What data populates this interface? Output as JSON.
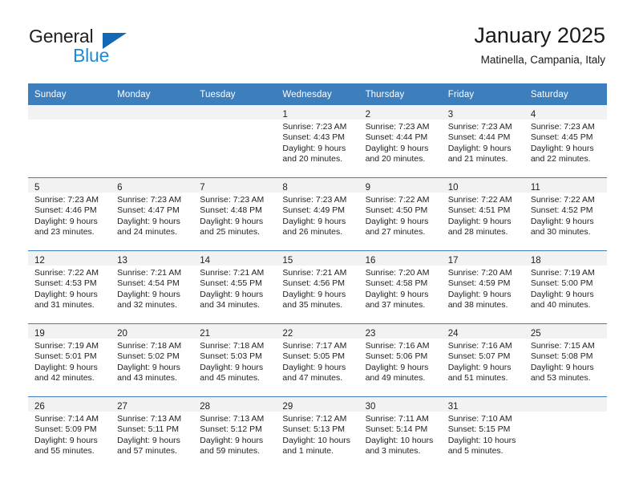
{
  "brand": {
    "name_part1": "General",
    "name_part2": "Blue",
    "triangle_color": "#1268b3",
    "blue_color": "#1e8ad6"
  },
  "header": {
    "month_title": "January 2025",
    "location": "Matinella, Campania, Italy"
  },
  "theme": {
    "header_blue": "#3d7ebd",
    "daynum_band": "#f2f2f2",
    "text": "#222222"
  },
  "weekday_headers": [
    "Sunday",
    "Monday",
    "Tuesday",
    "Wednesday",
    "Thursday",
    "Friday",
    "Saturday"
  ],
  "weeks": [
    [
      {
        "day": "",
        "sunrise": "",
        "sunset": "",
        "daylight_1": "",
        "daylight_2": ""
      },
      {
        "day": "",
        "sunrise": "",
        "sunset": "",
        "daylight_1": "",
        "daylight_2": ""
      },
      {
        "day": "",
        "sunrise": "",
        "sunset": "",
        "daylight_1": "",
        "daylight_2": ""
      },
      {
        "day": "1",
        "sunrise": "Sunrise: 7:23 AM",
        "sunset": "Sunset: 4:43 PM",
        "daylight_1": "Daylight: 9 hours",
        "daylight_2": "and 20 minutes."
      },
      {
        "day": "2",
        "sunrise": "Sunrise: 7:23 AM",
        "sunset": "Sunset: 4:44 PM",
        "daylight_1": "Daylight: 9 hours",
        "daylight_2": "and 20 minutes."
      },
      {
        "day": "3",
        "sunrise": "Sunrise: 7:23 AM",
        "sunset": "Sunset: 4:44 PM",
        "daylight_1": "Daylight: 9 hours",
        "daylight_2": "and 21 minutes."
      },
      {
        "day": "4",
        "sunrise": "Sunrise: 7:23 AM",
        "sunset": "Sunset: 4:45 PM",
        "daylight_1": "Daylight: 9 hours",
        "daylight_2": "and 22 minutes."
      }
    ],
    [
      {
        "day": "5",
        "sunrise": "Sunrise: 7:23 AM",
        "sunset": "Sunset: 4:46 PM",
        "daylight_1": "Daylight: 9 hours",
        "daylight_2": "and 23 minutes."
      },
      {
        "day": "6",
        "sunrise": "Sunrise: 7:23 AM",
        "sunset": "Sunset: 4:47 PM",
        "daylight_1": "Daylight: 9 hours",
        "daylight_2": "and 24 minutes."
      },
      {
        "day": "7",
        "sunrise": "Sunrise: 7:23 AM",
        "sunset": "Sunset: 4:48 PM",
        "daylight_1": "Daylight: 9 hours",
        "daylight_2": "and 25 minutes."
      },
      {
        "day": "8",
        "sunrise": "Sunrise: 7:23 AM",
        "sunset": "Sunset: 4:49 PM",
        "daylight_1": "Daylight: 9 hours",
        "daylight_2": "and 26 minutes."
      },
      {
        "day": "9",
        "sunrise": "Sunrise: 7:22 AM",
        "sunset": "Sunset: 4:50 PM",
        "daylight_1": "Daylight: 9 hours",
        "daylight_2": "and 27 minutes."
      },
      {
        "day": "10",
        "sunrise": "Sunrise: 7:22 AM",
        "sunset": "Sunset: 4:51 PM",
        "daylight_1": "Daylight: 9 hours",
        "daylight_2": "and 28 minutes."
      },
      {
        "day": "11",
        "sunrise": "Sunrise: 7:22 AM",
        "sunset": "Sunset: 4:52 PM",
        "daylight_1": "Daylight: 9 hours",
        "daylight_2": "and 30 minutes."
      }
    ],
    [
      {
        "day": "12",
        "sunrise": "Sunrise: 7:22 AM",
        "sunset": "Sunset: 4:53 PM",
        "daylight_1": "Daylight: 9 hours",
        "daylight_2": "and 31 minutes."
      },
      {
        "day": "13",
        "sunrise": "Sunrise: 7:21 AM",
        "sunset": "Sunset: 4:54 PM",
        "daylight_1": "Daylight: 9 hours",
        "daylight_2": "and 32 minutes."
      },
      {
        "day": "14",
        "sunrise": "Sunrise: 7:21 AM",
        "sunset": "Sunset: 4:55 PM",
        "daylight_1": "Daylight: 9 hours",
        "daylight_2": "and 34 minutes."
      },
      {
        "day": "15",
        "sunrise": "Sunrise: 7:21 AM",
        "sunset": "Sunset: 4:56 PM",
        "daylight_1": "Daylight: 9 hours",
        "daylight_2": "and 35 minutes."
      },
      {
        "day": "16",
        "sunrise": "Sunrise: 7:20 AM",
        "sunset": "Sunset: 4:58 PM",
        "daylight_1": "Daylight: 9 hours",
        "daylight_2": "and 37 minutes."
      },
      {
        "day": "17",
        "sunrise": "Sunrise: 7:20 AM",
        "sunset": "Sunset: 4:59 PM",
        "daylight_1": "Daylight: 9 hours",
        "daylight_2": "and 38 minutes."
      },
      {
        "day": "18",
        "sunrise": "Sunrise: 7:19 AM",
        "sunset": "Sunset: 5:00 PM",
        "daylight_1": "Daylight: 9 hours",
        "daylight_2": "and 40 minutes."
      }
    ],
    [
      {
        "day": "19",
        "sunrise": "Sunrise: 7:19 AM",
        "sunset": "Sunset: 5:01 PM",
        "daylight_1": "Daylight: 9 hours",
        "daylight_2": "and 42 minutes."
      },
      {
        "day": "20",
        "sunrise": "Sunrise: 7:18 AM",
        "sunset": "Sunset: 5:02 PM",
        "daylight_1": "Daylight: 9 hours",
        "daylight_2": "and 43 minutes."
      },
      {
        "day": "21",
        "sunrise": "Sunrise: 7:18 AM",
        "sunset": "Sunset: 5:03 PM",
        "daylight_1": "Daylight: 9 hours",
        "daylight_2": "and 45 minutes."
      },
      {
        "day": "22",
        "sunrise": "Sunrise: 7:17 AM",
        "sunset": "Sunset: 5:05 PM",
        "daylight_1": "Daylight: 9 hours",
        "daylight_2": "and 47 minutes."
      },
      {
        "day": "23",
        "sunrise": "Sunrise: 7:16 AM",
        "sunset": "Sunset: 5:06 PM",
        "daylight_1": "Daylight: 9 hours",
        "daylight_2": "and 49 minutes."
      },
      {
        "day": "24",
        "sunrise": "Sunrise: 7:16 AM",
        "sunset": "Sunset: 5:07 PM",
        "daylight_1": "Daylight: 9 hours",
        "daylight_2": "and 51 minutes."
      },
      {
        "day": "25",
        "sunrise": "Sunrise: 7:15 AM",
        "sunset": "Sunset: 5:08 PM",
        "daylight_1": "Daylight: 9 hours",
        "daylight_2": "and 53 minutes."
      }
    ],
    [
      {
        "day": "26",
        "sunrise": "Sunrise: 7:14 AM",
        "sunset": "Sunset: 5:09 PM",
        "daylight_1": "Daylight: 9 hours",
        "daylight_2": "and 55 minutes."
      },
      {
        "day": "27",
        "sunrise": "Sunrise: 7:13 AM",
        "sunset": "Sunset: 5:11 PM",
        "daylight_1": "Daylight: 9 hours",
        "daylight_2": "and 57 minutes."
      },
      {
        "day": "28",
        "sunrise": "Sunrise: 7:13 AM",
        "sunset": "Sunset: 5:12 PM",
        "daylight_1": "Daylight: 9 hours",
        "daylight_2": "and 59 minutes."
      },
      {
        "day": "29",
        "sunrise": "Sunrise: 7:12 AM",
        "sunset": "Sunset: 5:13 PM",
        "daylight_1": "Daylight: 10 hours",
        "daylight_2": "and 1 minute."
      },
      {
        "day": "30",
        "sunrise": "Sunrise: 7:11 AM",
        "sunset": "Sunset: 5:14 PM",
        "daylight_1": "Daylight: 10 hours",
        "daylight_2": "and 3 minutes."
      },
      {
        "day": "31",
        "sunrise": "Sunrise: 7:10 AM",
        "sunset": "Sunset: 5:15 PM",
        "daylight_1": "Daylight: 10 hours",
        "daylight_2": "and 5 minutes."
      },
      {
        "day": "",
        "sunrise": "",
        "sunset": "",
        "daylight_1": "",
        "daylight_2": ""
      }
    ]
  ]
}
